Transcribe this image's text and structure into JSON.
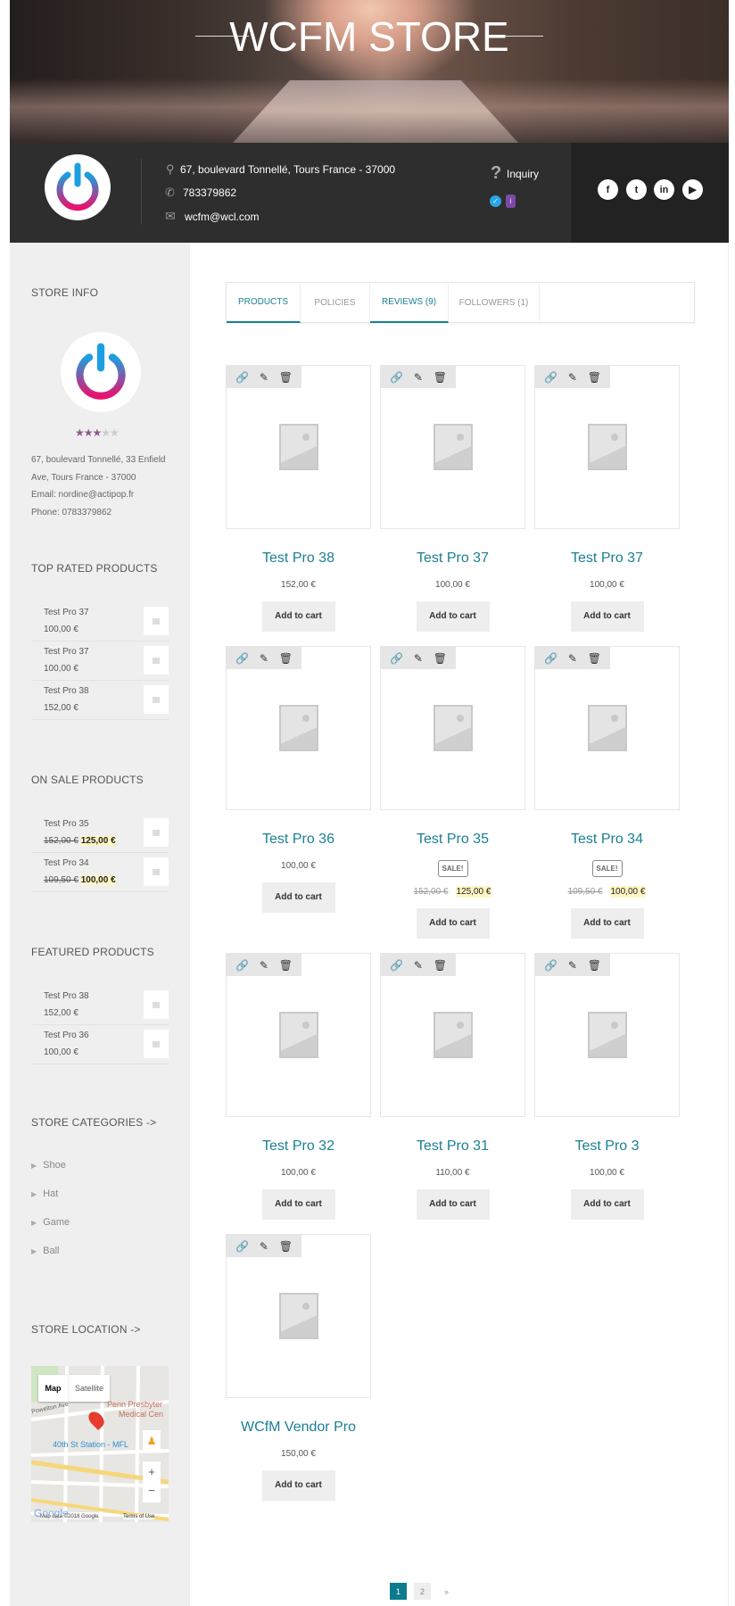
{
  "banner": {
    "store_name": "WCFM STORE"
  },
  "header": {
    "address": "67, boulevard Tonnellé, Tours France - 37000",
    "phone": "783379862",
    "email": "wcfm@wcl.com",
    "inquiry_label": "Inquiry",
    "social": [
      {
        "icon": "facebook-icon",
        "glyph": "f"
      },
      {
        "icon": "twitter-icon",
        "glyph": "t"
      },
      {
        "icon": "linkedin-icon",
        "glyph": "in"
      },
      {
        "icon": "youtube-icon",
        "glyph": "▶"
      }
    ]
  },
  "sidebar": {
    "store_info": {
      "heading": "STORE INFO",
      "rating": 3,
      "rating_max": 5,
      "address_line1": "67, boulevard Tonnellé, 33 Enfield",
      "address_line2": "Ave, Tours France - 37000",
      "email": "Email: nordine@actipop.fr",
      "phone": "Phone: 0783379862"
    },
    "top_rated": {
      "heading": "TOP RATED PRODUCTS",
      "items": [
        {
          "name": "Test Pro 37",
          "price": "100,00 €"
        },
        {
          "name": "Test Pro 37",
          "price": "100,00 €"
        },
        {
          "name": "Test Pro 38",
          "price": "152,00 €"
        }
      ]
    },
    "on_sale": {
      "heading": "ON SALE PRODUCTS",
      "items": [
        {
          "name": "Test Pro 35",
          "regular": "152,00 €",
          "price": "125,00 €"
        },
        {
          "name": "Test Pro 34",
          "regular": "109,50 €",
          "price": "100,00 €"
        }
      ]
    },
    "featured": {
      "heading": "FEATURED PRODUCTS",
      "items": [
        {
          "name": "Test Pro 38",
          "price": "152,00 €"
        },
        {
          "name": "Test Pro 36",
          "price": "100,00 €"
        }
      ]
    },
    "categories": {
      "heading": "STORE CATEGORIES ->",
      "items": [
        "Shoe",
        "Hat",
        "Game",
        "Ball"
      ]
    },
    "location": {
      "heading": "STORE LOCATION ->",
      "map_btn": "Map",
      "satellite_btn": "Satellite",
      "label_station": "40th St Station - MFL",
      "label_hospital1": "Penn Presbyter",
      "label_hospital2": "Medical Cen",
      "label_street": "Powelton Ave",
      "attribution": "Map data ©2018 Google",
      "terms": "Terms of Use",
      "google": "Google"
    }
  },
  "tabs": [
    {
      "label": "PRODUCTS",
      "active": true
    },
    {
      "label": "POLICIES"
    },
    {
      "label": "REVIEWS (9)",
      "active": true
    },
    {
      "label": "FOLLOWERS (1)"
    }
  ],
  "products": [
    {
      "name": "Test Pro 38",
      "price": "152,00 €"
    },
    {
      "name": "Test Pro 37",
      "price": "100,00 €"
    },
    {
      "name": "Test Pro 37",
      "price": "100,00 €"
    },
    {
      "name": "Test Pro 36",
      "price": "100,00 €"
    },
    {
      "name": "Test Pro 35",
      "regular": "152,00 €",
      "price": "125,00 €",
      "sale": "SALE!"
    },
    {
      "name": "Test Pro 34",
      "regular": "109,50 €",
      "price": "100,00 €",
      "sale": "SALE!"
    },
    {
      "name": "Test Pro 32",
      "price": "100,00 €"
    },
    {
      "name": "Test Pro 31",
      "price": "110,00 €"
    },
    {
      "name": "Test Pro 3",
      "price": "100,00 €"
    },
    {
      "name": "WCfM Vendor Pro",
      "price": "150,00 €"
    }
  ],
  "add_to_cart": "Add to cart",
  "pagination": {
    "pages": [
      "1",
      "2"
    ],
    "current": "1",
    "next": "»"
  },
  "colors": {
    "accent": "#1a7f93",
    "header_bg": "#2e2e2e",
    "sidebar_bg": "#efefef",
    "sale_highlight": "#fff6c4"
  }
}
